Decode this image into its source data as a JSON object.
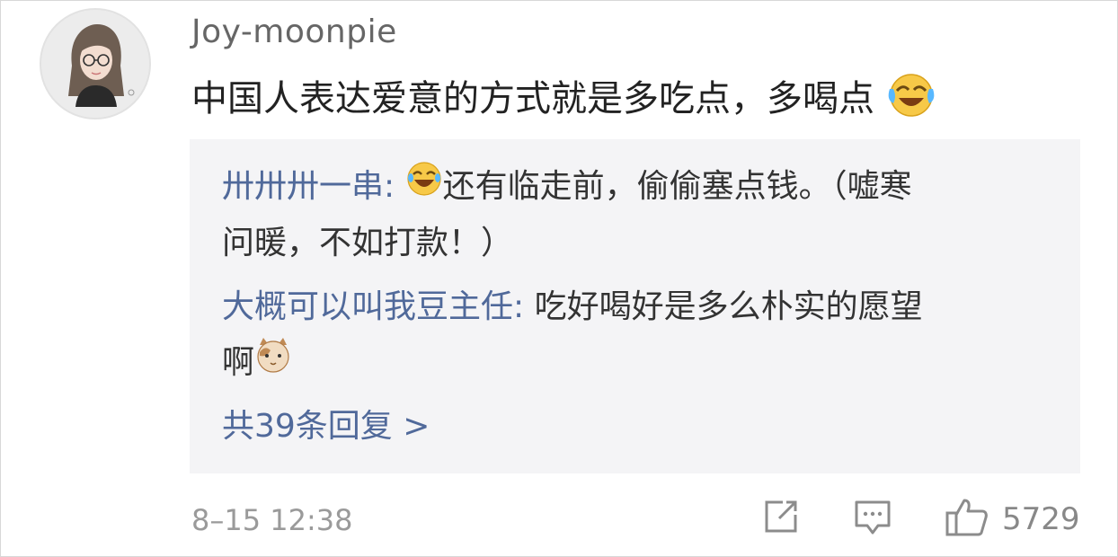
{
  "comment": {
    "username": "Joy-moonpie",
    "text": "中国人表达爱意的方式就是多吃点，多喝点",
    "emoji": "laughing-emoji"
  },
  "replies": [
    {
      "author": "卅卅卅一串",
      "separator": ":",
      "emoji": "tears-of-joy-emoji",
      "text_line1": "还有临走前，偷偷塞点钱。（嘘寒",
      "text_line2": "问暖，不如打款！）"
    },
    {
      "author": "大概可以叫我豆主任",
      "separator": ":",
      "text_line1": "吃好喝好是多么朴实的愿望",
      "text_line2": "啊",
      "emoji": "cat-emoji"
    }
  ],
  "more_replies": "共39条回复 >",
  "footer": {
    "timestamp": "8–15 12:38",
    "like_count": "5729",
    "icons": [
      "share-icon",
      "comment-icon",
      "like-icon"
    ]
  },
  "colors": {
    "link": "#50699a",
    "reply_background": "#f4f4f6",
    "muted": "#9a9a9a"
  }
}
